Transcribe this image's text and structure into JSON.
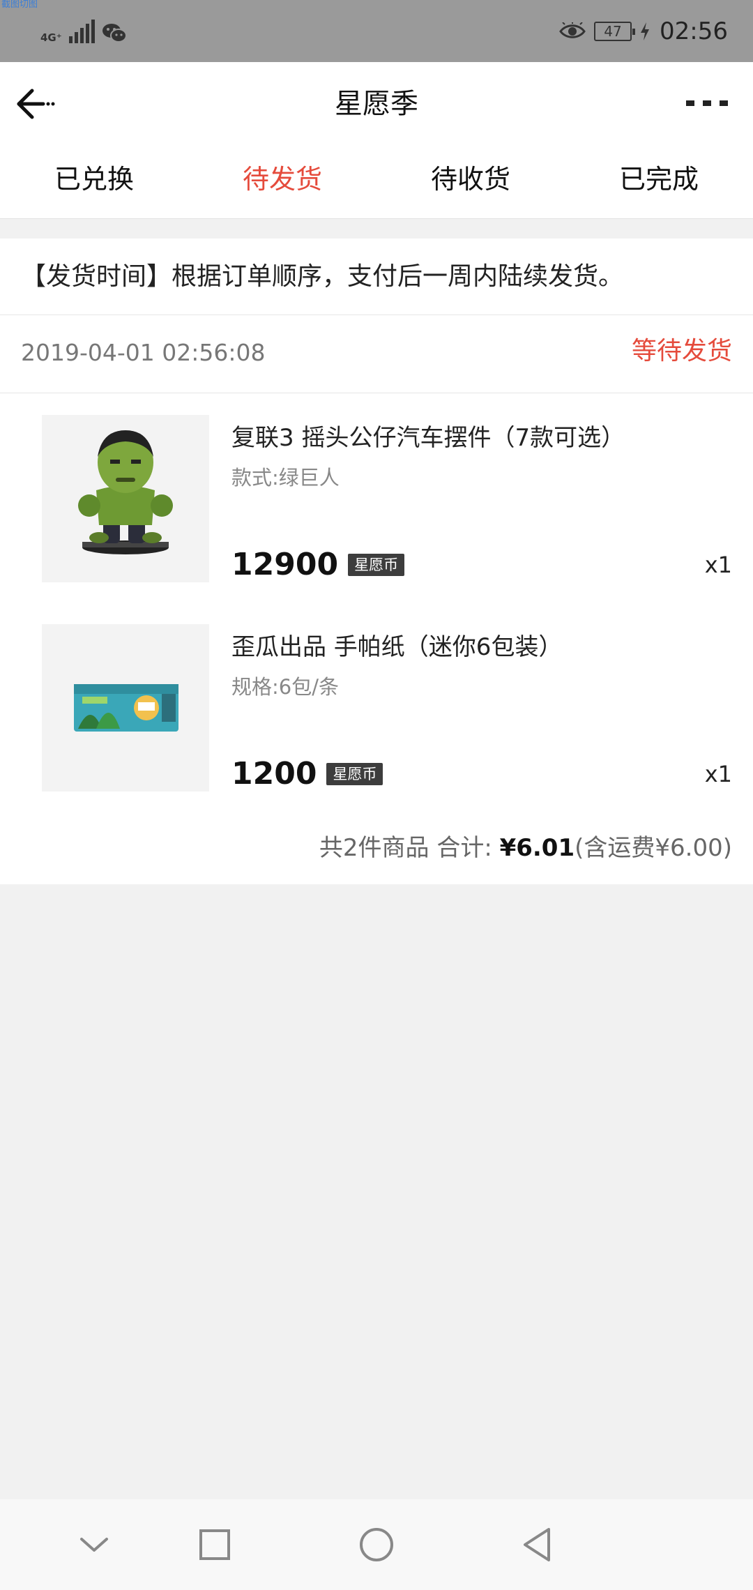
{
  "status_bar": {
    "tiny_text": "截图切图",
    "network": "4G⁺",
    "battery": "47",
    "time": "02:56",
    "icons": [
      "signal-icon",
      "wechat-icon",
      "eye-icon",
      "battery-icon",
      "charging-icon"
    ]
  },
  "header": {
    "title": "星愿季",
    "back_icon": "back-arrow-icon",
    "more_icon": "more-dots-icon"
  },
  "tabs": [
    {
      "label": "已兑换",
      "active": false
    },
    {
      "label": "待发货",
      "active": true
    },
    {
      "label": "待收货",
      "active": false
    },
    {
      "label": "已完成",
      "active": false
    }
  ],
  "notice": "【发货时间】根据订单顺序，支付后一周内陆续发货。",
  "order": {
    "time": "2019-04-01 02:56:08",
    "status": "等待发货",
    "items": [
      {
        "name": "复联3 摇头公仔汽车摆件（7款可选）",
        "spec": "款式:绿巨人",
        "price": "12900",
        "currency": "星愿币",
        "qty": "x1"
      },
      {
        "name": "歪瓜出品 手帕纸（迷你6包装）",
        "spec": "规格:6包/条",
        "price": "1200",
        "currency": "星愿币",
        "qty": "x1"
      }
    ],
    "total": {
      "prefix": "共2件商品 合计: ",
      "amount": "¥6.01",
      "shipping": "(含运费¥6.00)"
    }
  },
  "colors": {
    "accent": "#e54b3c",
    "status_bar": "#9a9a9a",
    "background": "#f1f1f1"
  },
  "navbar": {
    "icons": [
      "collapse-icon",
      "recents-icon",
      "home-icon",
      "back-icon"
    ]
  }
}
